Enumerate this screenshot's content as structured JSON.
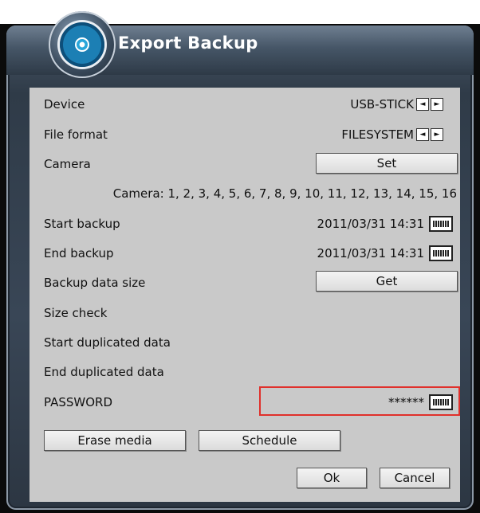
{
  "window": {
    "title": "Export Backup"
  },
  "rows": {
    "device": {
      "label": "Device",
      "value": "USB-STICK"
    },
    "file_format": {
      "label": "File format",
      "value": "FILESYSTEM"
    },
    "camera": {
      "label": "Camera",
      "button": "Set"
    },
    "camera_list": "Camera: 1, 2, 3, 4, 5, 6, 7, 8, 9, 10, 11, 12, 13, 14, 15, 16",
    "start_backup": {
      "label": "Start backup",
      "value": "2011/03/31 14:31"
    },
    "end_backup": {
      "label": "End backup",
      "value": "2011/03/31 14:31"
    },
    "backup_data_size": {
      "label": "Backup data size",
      "button": "Get"
    },
    "size_check": {
      "label": "Size check"
    },
    "start_duplicated": {
      "label": "Start duplicated data"
    },
    "end_duplicated": {
      "label": "End duplicated data"
    },
    "password": {
      "label": "PASSWORD",
      "value": "******"
    }
  },
  "buttons": {
    "erase_media": "Erase media",
    "schedule": "Schedule",
    "ok": "Ok",
    "cancel": "Cancel"
  },
  "icons": {
    "prev": "◄",
    "next": "►",
    "logo": "disc-icon",
    "keyboard": "keyboard-icon"
  },
  "colors": {
    "panel": "#c9c9c9",
    "highlight_border": "#e0302b"
  }
}
